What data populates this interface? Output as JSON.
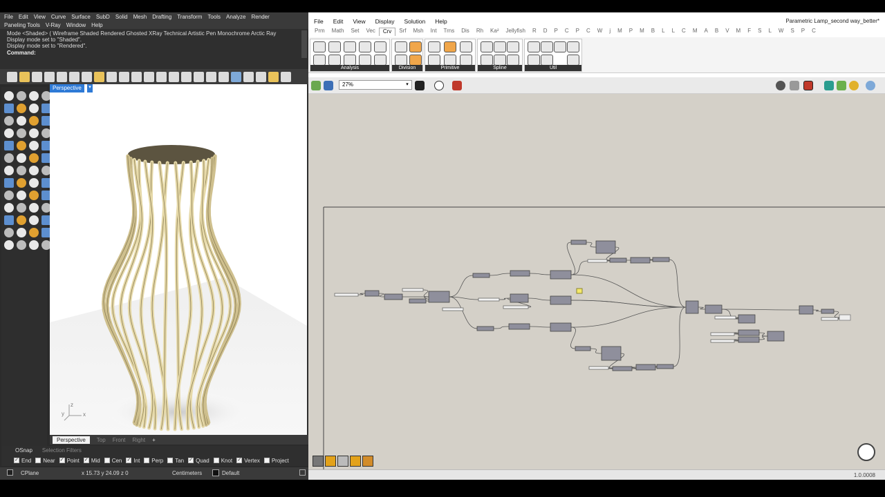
{
  "rhino": {
    "menu_row1": [
      "File",
      "Edit",
      "View",
      "Curve",
      "Surface",
      "SubD",
      "Solid",
      "Mesh",
      "Drafting",
      "Transform",
      "Tools",
      "Analyze",
      "Render"
    ],
    "menu_row2": [
      "Paneling Tools",
      "V-Ray",
      "Window",
      "Help"
    ],
    "history": [
      "Mode <Shaded> ( Wireframe  Shaded  Rendered  Ghosted  XRay  Technical  Artistic  Pen  Monochrome  Arctic  Ray",
      "Display mode set to \"Shaded\".",
      "Display mode set to \"Rendered\"."
    ],
    "command_label": "Command:",
    "viewport_label": "Perspective",
    "axis_x": "x",
    "axis_y": "y",
    "axis_z": "z",
    "viewport_tabs": [
      "Perspective",
      "Top",
      "Front",
      "Right"
    ],
    "viewport_tab_add": "+",
    "osnap_tabs": [
      "OSnap",
      "Selection Filters"
    ],
    "osnaps": [
      {
        "label": "End",
        "checked": true
      },
      {
        "label": "Near",
        "checked": false
      },
      {
        "label": "Point",
        "checked": true
      },
      {
        "label": "Mid",
        "checked": true
      },
      {
        "label": "Cen",
        "checked": false
      },
      {
        "label": "Int",
        "checked": true
      },
      {
        "label": "Perp",
        "checked": false
      },
      {
        "label": "Tan",
        "checked": false
      },
      {
        "label": "Quad",
        "checked": true
      },
      {
        "label": "Knot",
        "checked": false
      },
      {
        "label": "Vertex",
        "checked": true
      },
      {
        "label": "Project",
        "checked": false
      }
    ],
    "status": {
      "cplane": "CPlane",
      "coords": "x 15.73  y 24.09  z 0",
      "units": "Centimeters",
      "layer": "Default"
    }
  },
  "gh": {
    "title": "Parametric Lamp_second way_better*",
    "menu": [
      "File",
      "Edit",
      "View",
      "Display",
      "Solution",
      "Help"
    ],
    "tabs": [
      "Prm",
      "Math",
      "Set",
      "Vec",
      "Crv",
      "Srf",
      "Msh",
      "Int",
      "Trns",
      "Dis",
      "Rh",
      "Ka²",
      "Jellyfish",
      "R",
      "D",
      "P",
      "C",
      "P",
      "C",
      "W",
      "j",
      "M",
      "P",
      "M",
      "B",
      "L",
      "L",
      "C",
      "M",
      "A",
      "B",
      "V",
      "M",
      "F",
      "S",
      "L",
      "W",
      "S",
      "P",
      "C"
    ],
    "active_tab": "Crv",
    "groups": [
      "Analysis",
      "Division",
      "Primitive",
      "Spline",
      "Util"
    ],
    "zoom": "27%",
    "version": "1.0.0008",
    "colors": {
      "canvas": "#d4d0c8",
      "component": "#8f8f9c",
      "wire": "#555555",
      "panel": "#f4e86a"
    }
  }
}
